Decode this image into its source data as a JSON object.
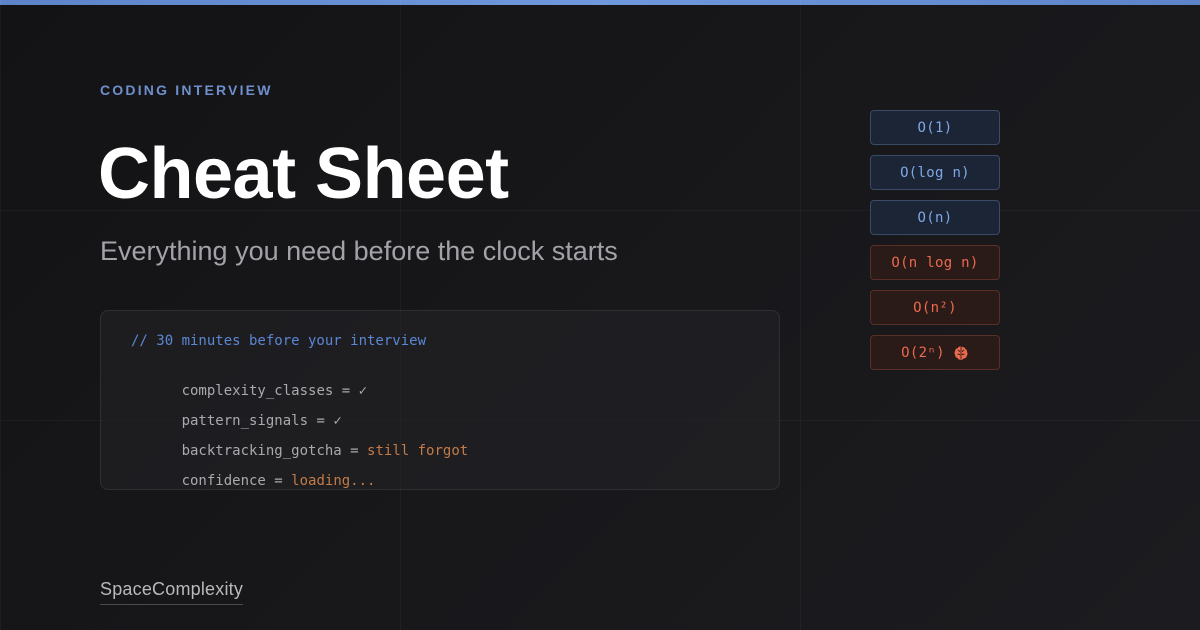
{
  "header": {
    "eyebrow": "CODING INTERVIEW",
    "title": "Cheat Sheet",
    "subtitle": "Everything you need before the clock starts"
  },
  "code_panel": {
    "comment": "// 30 minutes before your interview",
    "lines": [
      {
        "key": "complexity_classes",
        "operator": " = ",
        "value": "✓"
      },
      {
        "key": "pattern_signals",
        "operator": " = ",
        "value": "✓"
      },
      {
        "key": "backtracking_gotcha",
        "operator": " = ",
        "value": "still forgot"
      },
      {
        "key": "confidence",
        "operator": " = ",
        "value": "loading..."
      }
    ]
  },
  "complexity_chips": [
    {
      "label": "O(1)",
      "tone": "good"
    },
    {
      "label": "O(log n)",
      "tone": "good"
    },
    {
      "label": "O(n)",
      "tone": "good"
    },
    {
      "label": "O(n log n)",
      "tone": "bad"
    },
    {
      "label": "O(n²)",
      "tone": "bad"
    },
    {
      "label": "O(2ⁿ)",
      "tone": "bad",
      "icon": "brain-icon"
    }
  ],
  "brand": {
    "name": "SpaceComplexity"
  },
  "colors": {
    "accent": "#6e8fcc",
    "good": "#7fa7e8",
    "bad": "#ea6a4d",
    "warning_text": "#c27a49",
    "background": "#151517"
  }
}
